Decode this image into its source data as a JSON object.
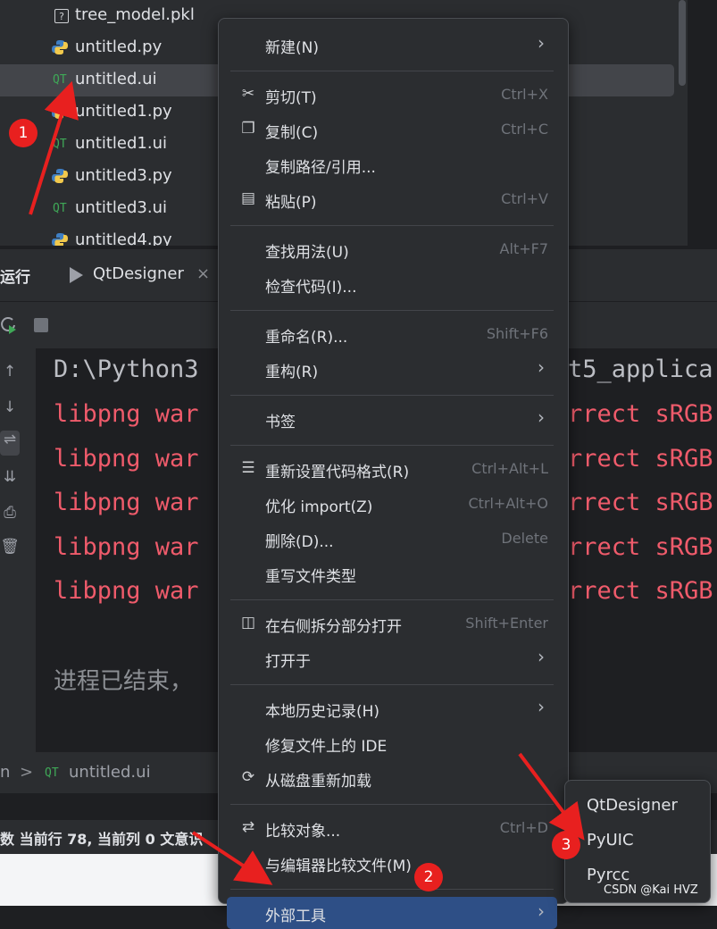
{
  "tree": {
    "items": [
      {
        "label": "tree_model.pkl",
        "icon": "unknown-file-icon"
      },
      {
        "label": "untitled.py",
        "icon": "python-icon"
      },
      {
        "label": "untitled.ui",
        "icon": "qt-icon",
        "selected": true
      },
      {
        "label": "untitled1.py",
        "icon": "python-icon"
      },
      {
        "label": "untitled1.ui",
        "icon": "qt-icon"
      },
      {
        "label": "untitled3.py",
        "icon": "python-icon"
      },
      {
        "label": "untitled3.ui",
        "icon": "qt-icon"
      },
      {
        "label": "untitled4.py",
        "icon": "python-icon"
      }
    ],
    "qt_glyph": "QT"
  },
  "run": {
    "title": "运行",
    "tab_label": "QtDesigner",
    "close_glyph": "×"
  },
  "console": {
    "cmd_start": "D:\\Python3",
    "cmd_end": "t5_applica",
    "err_start": "libpng war",
    "err_end": "rrect sRGB",
    "exit_text": "进程已结束，"
  },
  "breadcrumb": {
    "root": "n",
    "sep": ">",
    "file": "untitled.ui"
  },
  "status": {
    "text": "数  当前行 78, 当前列 0  文意识"
  },
  "menu": {
    "items": [
      {
        "label": "新建(N)",
        "submenu": true
      },
      {
        "sep": true
      },
      {
        "label": "剪切(T)",
        "shortcut": "Ctrl+X",
        "icon": "scissors-icon"
      },
      {
        "label": "复制(C)",
        "shortcut": "Ctrl+C",
        "icon": "copy-icon"
      },
      {
        "label": "复制路径/引用...",
        "submenu": false
      },
      {
        "label": "粘贴(P)",
        "shortcut": "Ctrl+V",
        "icon": "paste-icon"
      },
      {
        "sep": true
      },
      {
        "label": "查找用法(U)",
        "shortcut": "Alt+F7"
      },
      {
        "label": "检查代码(I)..."
      },
      {
        "sep": true
      },
      {
        "label": "重命名(R)...",
        "shortcut": "Shift+F6"
      },
      {
        "label": "重构(R)",
        "submenu": true
      },
      {
        "sep": true
      },
      {
        "label": "书签",
        "submenu": true
      },
      {
        "sep": true
      },
      {
        "label": "重新设置代码格式(R)",
        "shortcut": "Ctrl+Alt+L",
        "icon": "reformat-icon"
      },
      {
        "label": "优化 import(Z)",
        "shortcut": "Ctrl+Alt+O"
      },
      {
        "label": "删除(D)...",
        "shortcut": "Delete"
      },
      {
        "label": "重写文件类型"
      },
      {
        "sep": true
      },
      {
        "label": "在右侧拆分部分打开",
        "shortcut": "Shift+Enter",
        "icon": "split-icon"
      },
      {
        "label": "打开于",
        "submenu": true
      },
      {
        "sep": true
      },
      {
        "label": "本地历史记录(H)",
        "submenu": true
      },
      {
        "label": "修复文件上的 IDE"
      },
      {
        "label": "从磁盘重新加载",
        "icon": "reload-icon"
      },
      {
        "sep": true
      },
      {
        "label": "比较对象...",
        "shortcut": "Ctrl+D",
        "icon": "compare-icon"
      },
      {
        "label": "与编辑器比较文件(M)"
      },
      {
        "sep": true
      },
      {
        "label": "外部工具",
        "submenu": true,
        "active": true
      }
    ],
    "arrow_glyph": "›"
  },
  "submenu": {
    "items": [
      "QtDesigner",
      "PyUIC",
      "Pyrcc"
    ]
  },
  "annotations": {
    "badges": [
      "1",
      "2",
      "3"
    ],
    "color": "#e8201f"
  },
  "watermark": "CSDN @Kai    HVZ"
}
